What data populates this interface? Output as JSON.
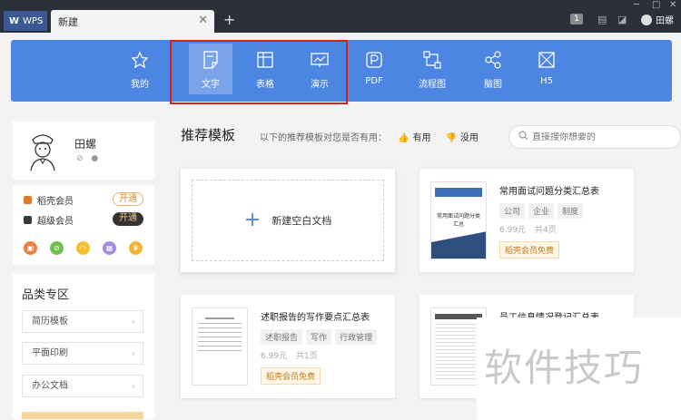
{
  "titlebar": {
    "app_tab": "WPS",
    "doc_tab": "新建",
    "badge": "1",
    "user": "田螺"
  },
  "toolbar": {
    "items": [
      {
        "label": "我的",
        "icon": "star-icon"
      },
      {
        "label": "文字",
        "icon": "document-icon"
      },
      {
        "label": "表格",
        "icon": "spreadsheet-icon"
      },
      {
        "label": "演示",
        "icon": "presentation-icon"
      },
      {
        "label": "PDF",
        "icon": "pdf-icon"
      },
      {
        "label": "流程图",
        "icon": "flowchart-icon"
      },
      {
        "label": "脑图",
        "icon": "mindmap-icon"
      },
      {
        "label": "H5",
        "icon": "h5-icon"
      }
    ],
    "active": "文字",
    "accent": "#4d85e3"
  },
  "profile": {
    "name": "田螺"
  },
  "membership": {
    "rows": [
      {
        "label": "稻壳会员",
        "button": "开通"
      },
      {
        "label": "超级会员",
        "button": "开通"
      }
    ]
  },
  "categories": {
    "title": "品类专区",
    "items": [
      "简历模板",
      "平面印刷",
      "办公文档"
    ]
  },
  "recommend": {
    "title": "推荐模板",
    "question": "以下的推荐模板对您是否有用：",
    "yes": "有用",
    "no": "没用"
  },
  "search": {
    "placeholder": "直接搜你想要的"
  },
  "new_blank": {
    "label": "新建空白文档"
  },
  "templates": [
    {
      "title": "常用面试问题分类汇总表",
      "tags": [
        "公司",
        "企业",
        "制度"
      ],
      "price": "6.99元",
      "pages": "共4页",
      "free": "稻壳会员免费",
      "thumb_title": "常用面试问题分类汇总"
    },
    {
      "title": "述职报告的写作要点汇总表",
      "tags": [
        "述职报告",
        "写作",
        "行政管理"
      ],
      "price": "6.99元",
      "pages": "共1页",
      "free": "稻壳会员免费"
    },
    {
      "title": "员工信息情况登记汇总表"
    }
  ],
  "watermark": "软件技巧"
}
